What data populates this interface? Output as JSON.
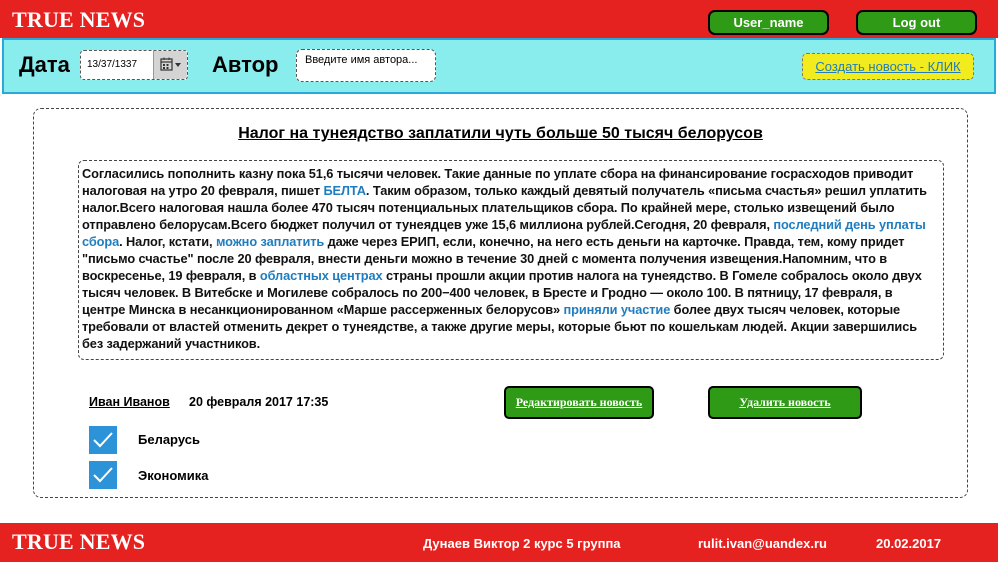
{
  "header": {
    "logo": "TRUE NEWS",
    "user_button": "User_name",
    "logout_button": "Log out"
  },
  "toolbar": {
    "date_label": "Дата",
    "date_value": "13/37/1337",
    "author_label": "Автор",
    "author_placeholder": "Введите имя автора...",
    "create_link": "Создать новость - КЛИК"
  },
  "article": {
    "title": "Налог на тунеядство заплатили чуть больше 50 тысяч белорусов",
    "body": [
      {
        "text": "Согласились  пополнить казну пока 51,6 тысячи человек. Такие данные по уплате сбора  на финансирование госрасходов приводит налоговая на утро 20 февраля,  пишет "
      },
      {
        "text": "БЕЛТА",
        "link": true
      },
      {
        "text": ". Таким образом, только каждый девятый получатель «письма счастья» решил уплатить налог.Всего налоговая нашла более 470 тысяч потенциальных плательщиков  сбора. По крайней мере, столько извещений было отправлено белорусам.Всего бюджет получил от тунеядцев уже 15,6 миллиона рублей.Сегодня, 20 февраля, "
      },
      {
        "text": "последний день уплаты сбора",
        "link": true
      },
      {
        "text": ". Налог, кстати, "
      },
      {
        "text": "можно заплатить",
        "link": true
      },
      {
        "text": "  даже через ЕРИП, если, конечно, на него есть деньги на карточке.  Правда, тем, кому придет \"письмо счастье\" после 20 февраля, внести  деньги можно в течение 30 дней с момента получения извещения.Напомним, что в воскресенье, 19 февраля, в "
      },
      {
        "text": "областных центрах",
        "link": true
      },
      {
        "text": "  страны прошли акции против налога на тунеядство. В Гомеле собралось  около двух тысяч человек. В Витебске и Могилеве собралось по 200−400  человек, в Бресте и Гродно — около 100. В пятницу, 17 февраля, в центре  Минска в несанкционированном «Марше рассерженных белорусов» "
      },
      {
        "text": "приняли участие",
        "link": true
      },
      {
        "text": "  более двух тысяч человек, которые требовали от властей отменить декрет  о тунеядстве, а также другие меры, которые бьют по кошелькам людей.  Акции завершились без задержаний участников."
      }
    ],
    "author": "Иван Иванов",
    "date": "20 февраля 2017  17:35",
    "edit_button": "Редактировать новость",
    "delete_button": "Удалить новость",
    "tags": [
      "Беларусь",
      "Экономика"
    ]
  },
  "footer": {
    "logo": "TRUE NEWS",
    "student": "Дунаев Виктор  2 курс 5 группа",
    "email": "rulit.ivan@uandex.ru",
    "date": "20.02.2017"
  },
  "colors": {
    "brand_red": "#e52220",
    "button_green": "#2e9a15",
    "toolbar_cyan": "#8aeded",
    "link_blue": "#1f7dbf",
    "highlight_yellow": "#f2ec1e",
    "checkbox_blue": "#2d93d8"
  }
}
